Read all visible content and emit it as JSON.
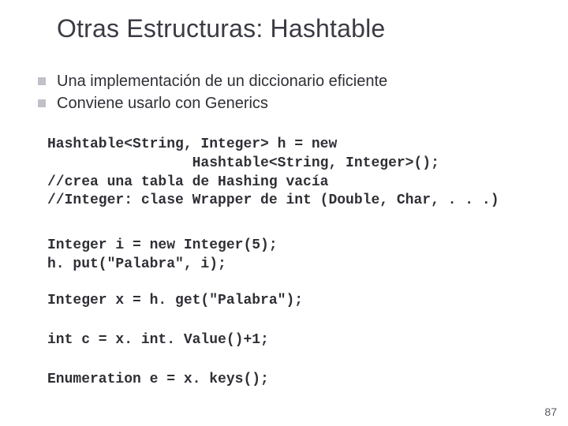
{
  "title": "Otras Estructuras: Hashtable",
  "bullets": [
    "Una implementación de un diccionario eficiente",
    "Conviene usarlo con Generics"
  ],
  "code": {
    "block1": "Hashtable<String, Integer> h = new\n                 Hashtable<String, Integer>();\n//crea una tabla de Hashing vacía\n//Integer: clase Wrapper de int (Double, Char, . . .)",
    "block2": "Integer i = new Integer(5);\nh. put(\"Palabra\", i);",
    "block3": "Integer x = h. get(\"Palabra\");",
    "block4": "int c = x. int. Value()+1;",
    "block5": "Enumeration e = x. keys();"
  },
  "pageNumber": "87"
}
